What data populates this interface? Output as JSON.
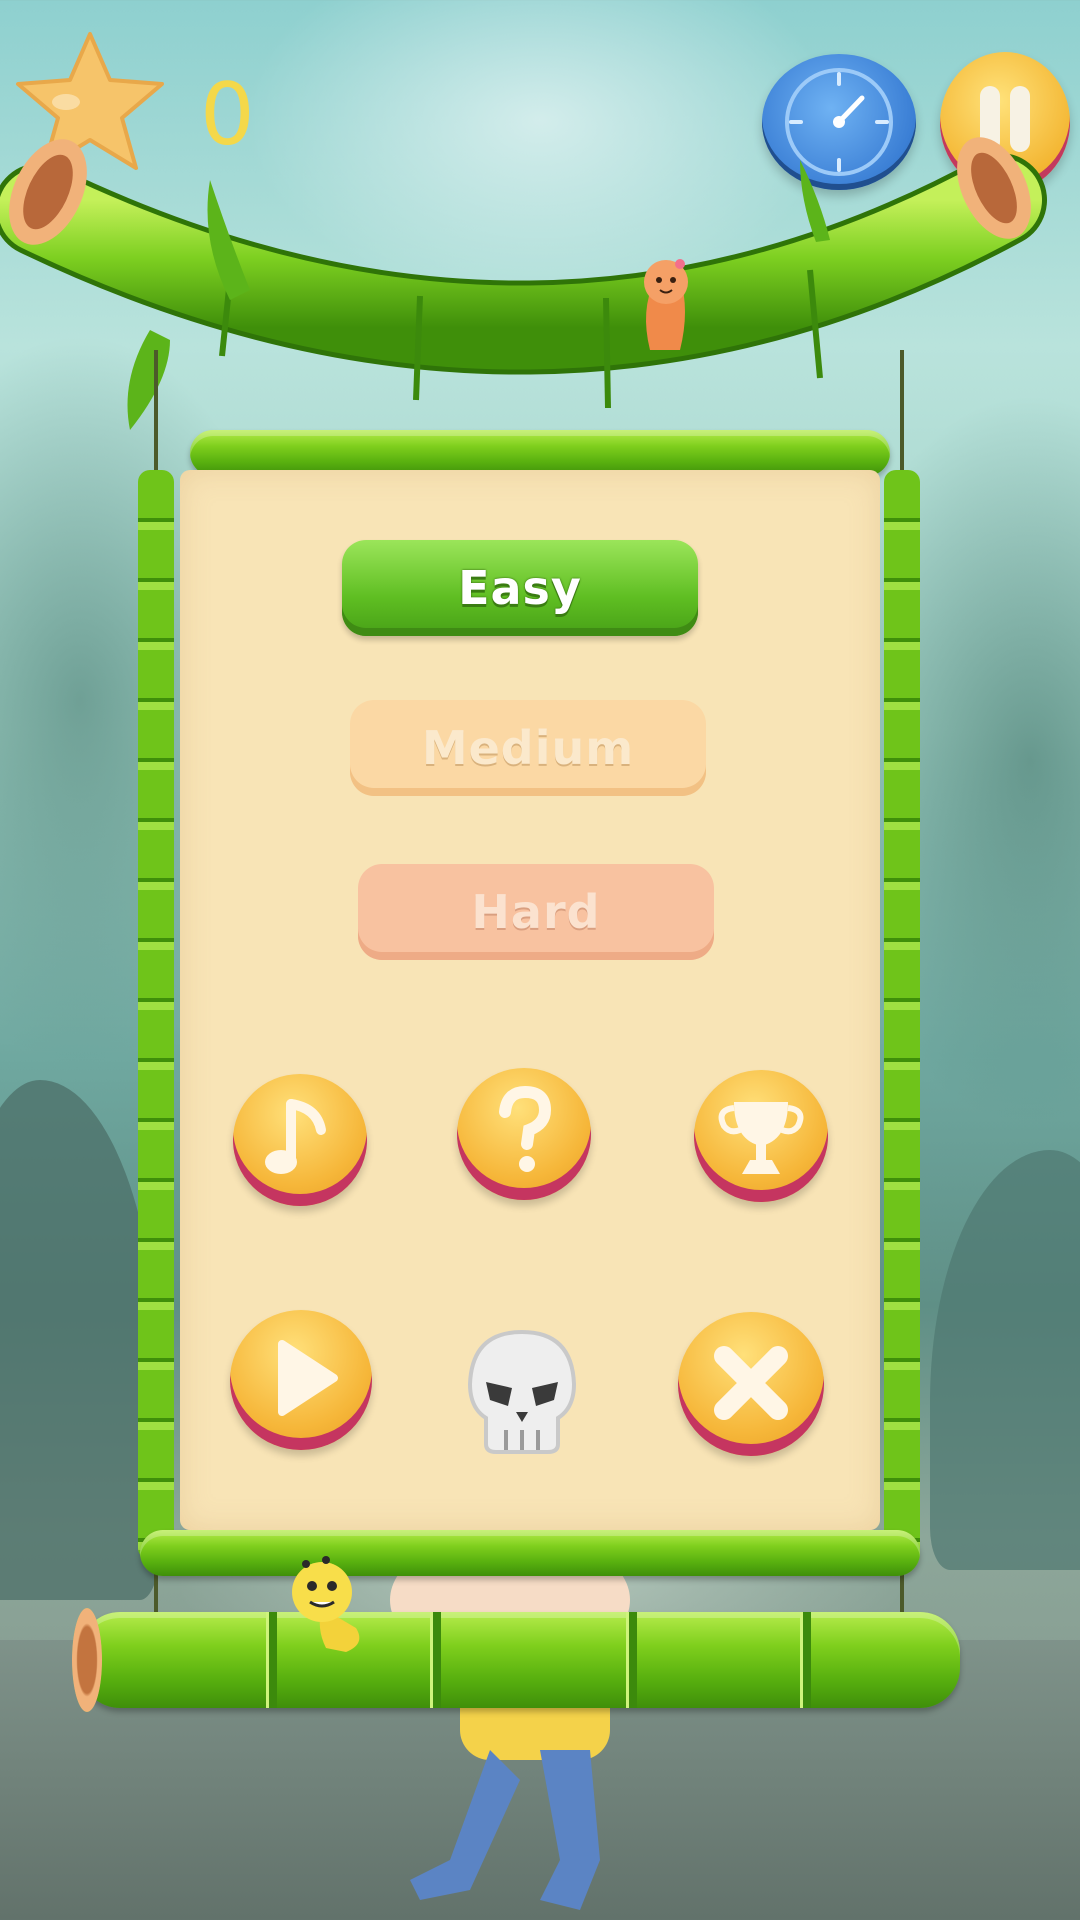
{
  "hud": {
    "score": "0",
    "star_icon": "star-icon",
    "clock_icon": "clock-icon",
    "pause_icon": "pause-icon"
  },
  "menu": {
    "difficulty": [
      {
        "label": "Easy",
        "state": "selected"
      },
      {
        "label": "Medium",
        "state": "disabled"
      },
      {
        "label": "Hard",
        "state": "disabled"
      }
    ],
    "icon_buttons": [
      "music-note-icon",
      "help-icon",
      "trophy-icon",
      "play-icon",
      "skull-icon",
      "close-icon"
    ]
  },
  "colors": {
    "bamboo": "#6fc41a",
    "panel": "#f8e4b6",
    "button_gold": "#f6b73a",
    "easy_green": "#5fbe22"
  }
}
